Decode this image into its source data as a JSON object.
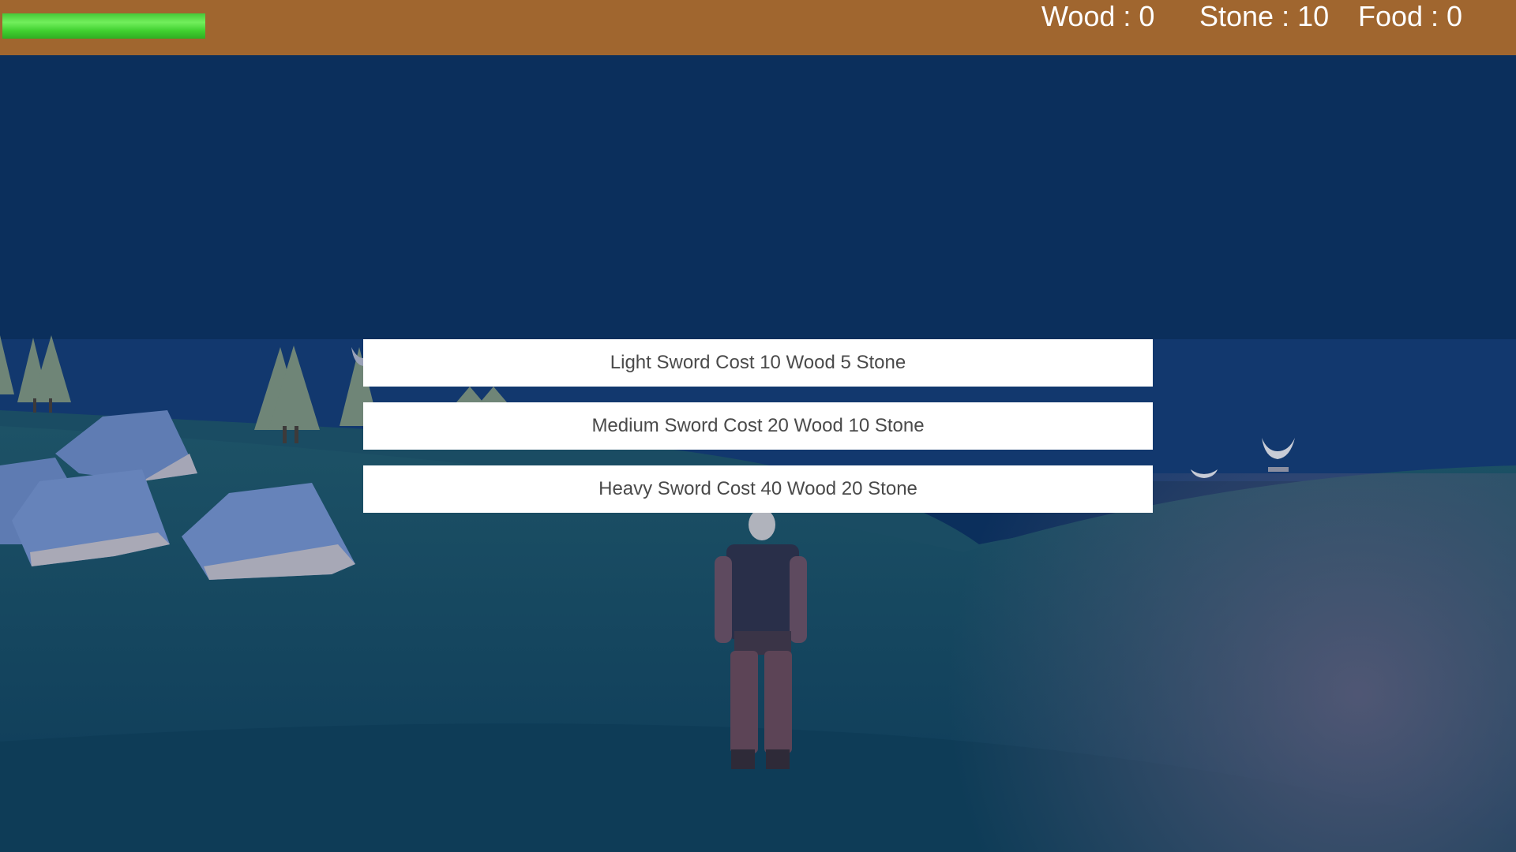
{
  "hud": {
    "health_fraction": 1.0,
    "resources": {
      "wood": "Wood : 0",
      "stone": "Stone : 10",
      "food": "Food : 0"
    }
  },
  "craft_menu": {
    "items": [
      {
        "label": "Light Sword Cost 10 Wood 5 Stone"
      },
      {
        "label": "Medium Sword Cost 20 Wood 10 Stone"
      },
      {
        "label": "Heavy Sword Cost 40 Wood 20 Stone"
      }
    ]
  },
  "colors": {
    "topbar": "#a0662f",
    "sky": "#0b2f5c",
    "ground": "#124660",
    "health": "#3fcf2f",
    "button_bg": "#ffffff",
    "button_text": "#4a4a4a"
  },
  "scene": {
    "character": "player-character",
    "props": [
      "pine-trees",
      "boulders",
      "horned-creatures"
    ]
  }
}
